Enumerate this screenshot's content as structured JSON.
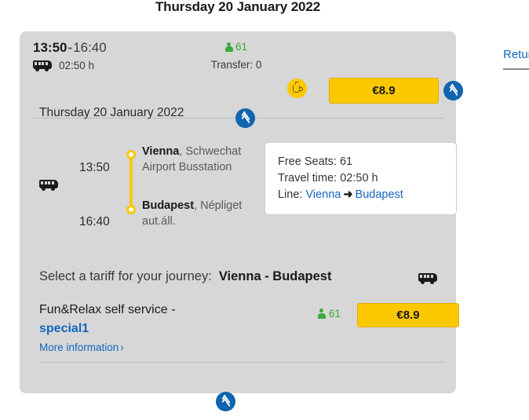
{
  "page": {
    "title": "Thursday 20 January 2022"
  },
  "return_tab": {
    "label": "Return"
  },
  "journey": {
    "header": {
      "departure_time": "13:50",
      "time_separator": "-",
      "arrival_time": "16:40",
      "duration": "02:50 h",
      "free_seats": "61",
      "transfers": "Transfer: 0",
      "price": "€8.9",
      "amenity_icon": "coffee-icon",
      "collapse_icon": "chevron-double-up-icon",
      "bus_icon": "bus-icon"
    },
    "detail": {
      "date": "Thursday 20 January 2022",
      "legs": [
        {
          "vehicle_icon": "bus-icon",
          "departure_time": "13:50",
          "arrival_time": "16:40",
          "from_city": "Vienna",
          "from_place": ", Schwechat Airport Busstation",
          "to_city": "Budapest",
          "to_place": ", Népliget aut.áll."
        }
      ],
      "info": {
        "free_seats_label": "Free Seats:",
        "free_seats_value": "61",
        "travel_time_label": "Travel time:",
        "travel_time_value": "02:50 h",
        "line_label": "Line:",
        "line_origin": "Vienna",
        "line_arrow": "➜",
        "line_destination": "Budapest"
      }
    },
    "tariff": {
      "prompt": "Select a tariff for your journey:",
      "route": "Vienna - Budapest",
      "vehicle_icon": "bus-icon",
      "options": [
        {
          "name": "Fun&Relax self service -",
          "variant": "special1",
          "more_information": "More information",
          "more_caret": "›",
          "free_seats": "61",
          "price": "€8.9"
        }
      ]
    },
    "footer": {
      "collapse_icon": "chevron-double-up-icon"
    }
  },
  "colors": {
    "brand_blue": "#1164ae",
    "link_blue": "#1565c0",
    "accent_yellow": "#fcc800",
    "seats_green": "#3aa93a",
    "card_gray": "#d7d7d7"
  }
}
